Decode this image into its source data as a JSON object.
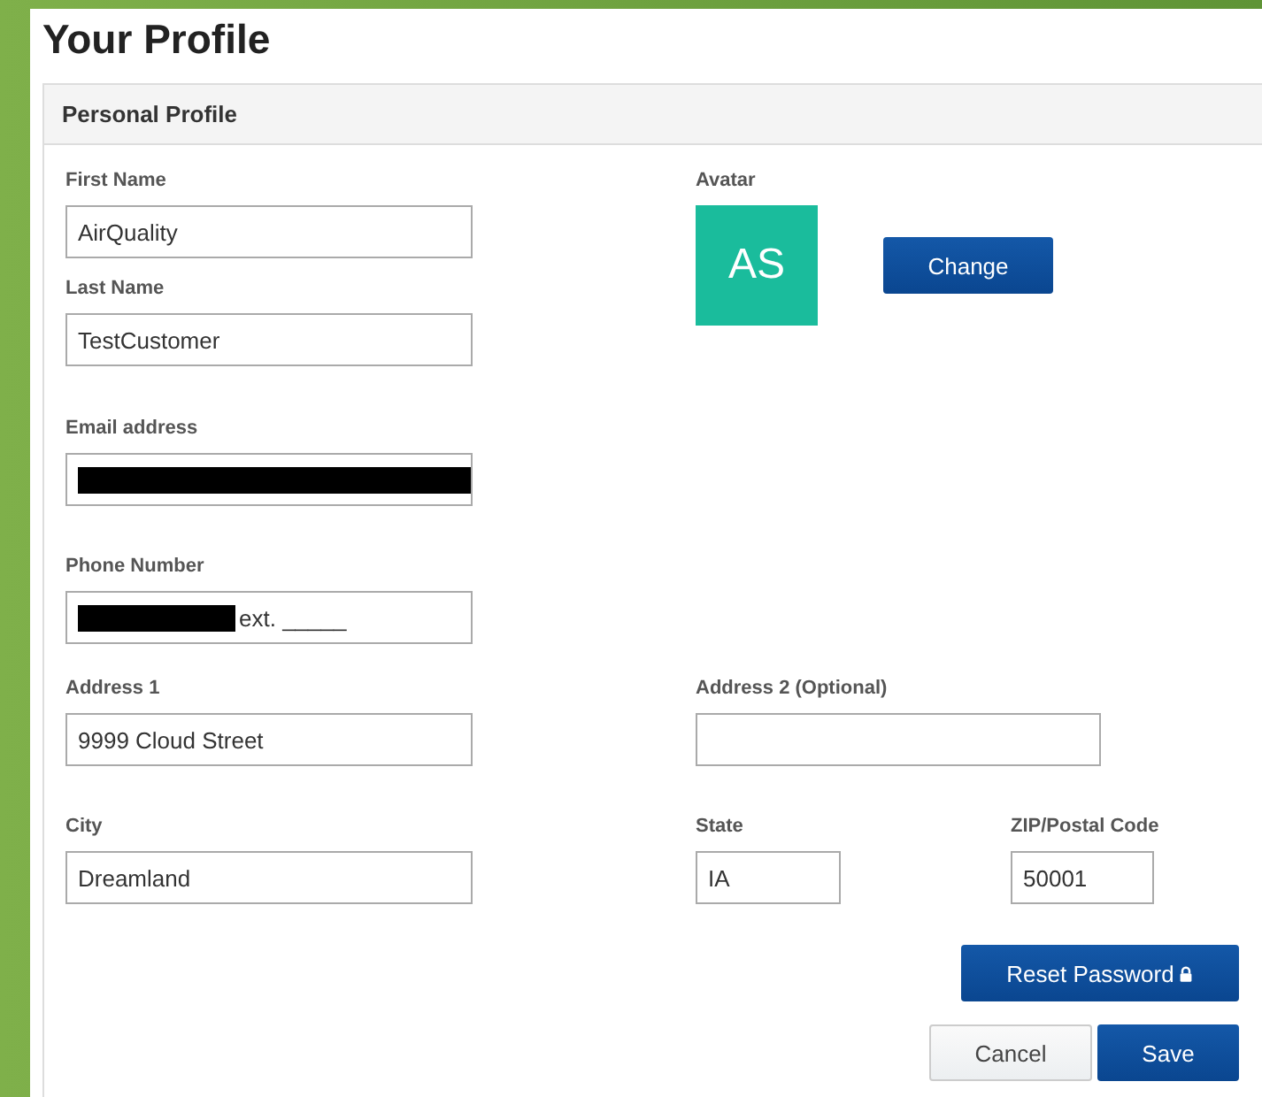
{
  "page": {
    "title": "Your Profile"
  },
  "panel": {
    "title": "Personal Profile"
  },
  "fields": {
    "first_name": {
      "label": "First Name",
      "value": "AirQuality"
    },
    "last_name": {
      "label": "Last Name",
      "value": "TestCustomer"
    },
    "email": {
      "label": "Email address",
      "redacted": true
    },
    "phone": {
      "label": "Phone Number",
      "redacted": true,
      "value": "ext. _____"
    },
    "address1": {
      "label": "Address 1",
      "value": "9999 Cloud Street"
    },
    "address2": {
      "label": "Address 2 (Optional)"
    },
    "city": {
      "label": "City",
      "value": "Dreamland"
    },
    "state": {
      "label": "State",
      "value": "IA"
    },
    "zip": {
      "label": "ZIP/Postal Code",
      "value": "50001"
    }
  },
  "avatar": {
    "label": "Avatar",
    "initials": "AS",
    "color": "#1abc9c",
    "button": "Change"
  },
  "buttons": {
    "reset_password": "Reset Password",
    "cancel": "Cancel",
    "save": "Save"
  }
}
